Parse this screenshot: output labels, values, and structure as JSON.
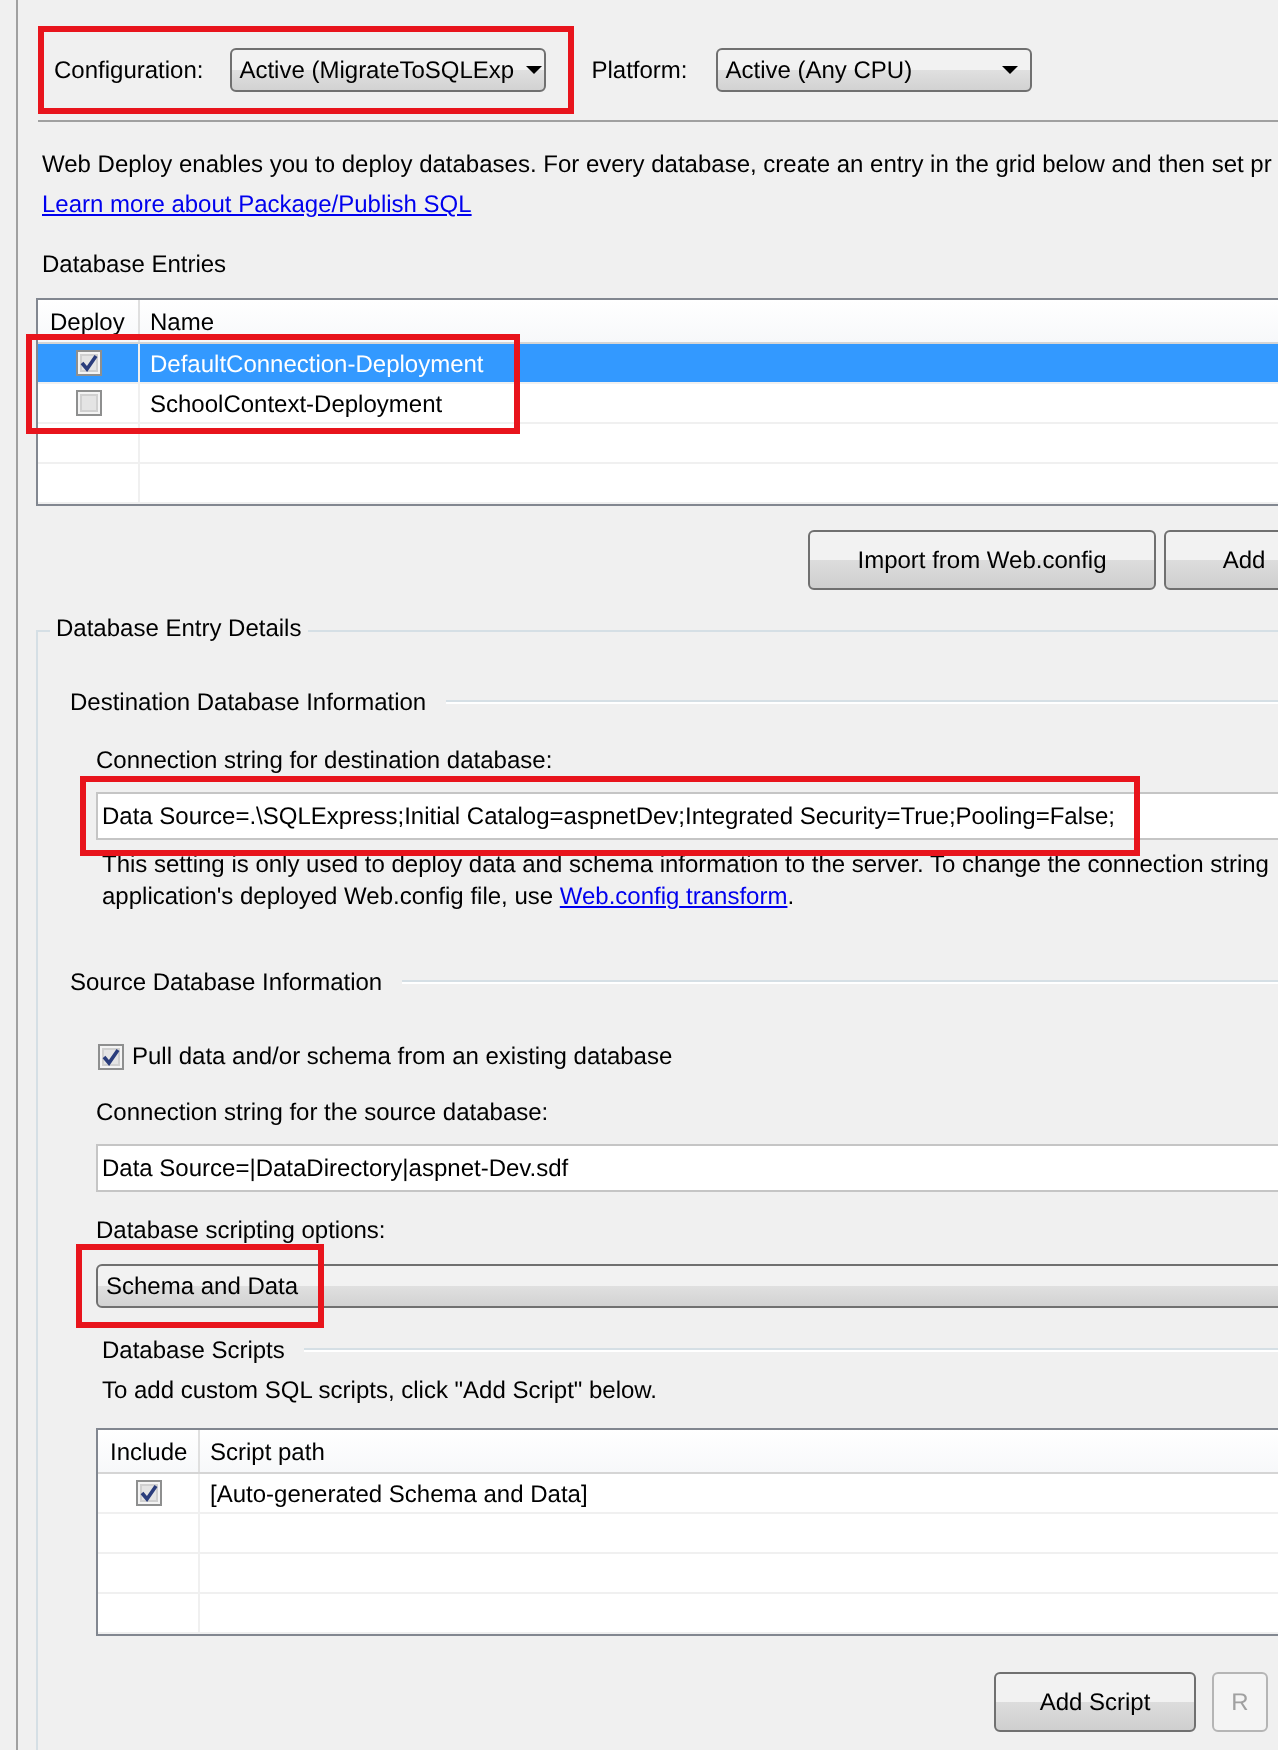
{
  "configuration": {
    "label": "Configuration:",
    "value": "Active (MigrateToSQLExp",
    "highlighted": true
  },
  "platform": {
    "label": "Platform:",
    "value": "Active (Any CPU)",
    "highlighted": false
  },
  "intro": {
    "text": "Web Deploy enables you to deploy databases. For every database, create an entry in the grid below and then set pr",
    "link": "Learn more about Package/Publish SQL"
  },
  "database_entries": {
    "title": "Database Entries",
    "highlighted": true,
    "columns": [
      "Deploy",
      "Name"
    ],
    "rows": [
      {
        "deploy": true,
        "name": "DefaultConnection-Deployment",
        "selected": true
      },
      {
        "deploy": false,
        "name": "SchoolContext-Deployment",
        "selected": false
      }
    ]
  },
  "entry_buttons": [
    {
      "label": "Import from Web.config",
      "disabled": false
    },
    {
      "label": "Add",
      "disabled": false
    }
  ],
  "details": {
    "title": "Database Entry Details",
    "destination": {
      "title": "Destination Database Information",
      "label": "Connection string for destination database:",
      "value": "Data Source=.\\SQLExpress;Initial Catalog=aspnetDev;Integrated Security=True;Pooling=False;",
      "highlighted": true,
      "note_lines": [
        "This setting is only used to deploy data and schema information to the server. To change the connection string",
        "application's deployed Web.config file, use "
      ],
      "note_link": "Web.config transform",
      "note_end": "."
    },
    "source": {
      "title": "Source Database Information",
      "pull": {
        "label": "Pull data and/or schema from an existing database",
        "checked": true
      },
      "label": "Connection string for the source database:",
      "value": "Data Source=|DataDirectory|aspnet-Dev.sdf",
      "scripting_label": "Database scripting options:",
      "scripting_value": "Schema and Data",
      "scripting_highlighted": true
    },
    "scripts": {
      "title": "Database Scripts",
      "hint": "To add custom SQL scripts, click \"Add Script\" below.",
      "columns": [
        "Include",
        "Script path"
      ],
      "rows": [
        {
          "include": true,
          "path": "[Auto-generated Schema and Data]",
          "selected": false
        }
      ]
    },
    "script_buttons": [
      {
        "label": "Add Script",
        "disabled": false
      },
      {
        "label": "R",
        "disabled": true
      }
    ]
  }
}
